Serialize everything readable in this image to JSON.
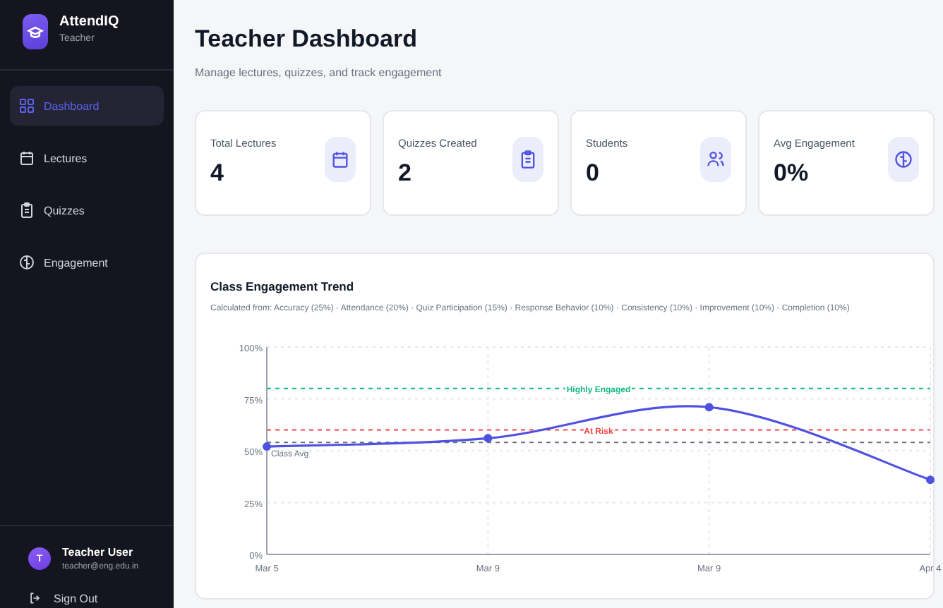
{
  "sidebar": {
    "brand": {
      "name": "AttendIQ",
      "role": "Teacher"
    },
    "items": [
      {
        "label": "Dashboard",
        "selected": true
      },
      {
        "label": "Lectures",
        "selected": false
      },
      {
        "label": "Quizzes",
        "selected": false
      },
      {
        "label": "Engagement",
        "selected": false
      }
    ],
    "user": {
      "initial": "T",
      "name": "Teacher User",
      "email": "teacher@eng.edu.in"
    },
    "sign_out": "Sign Out"
  },
  "header": {
    "title": "Teacher Dashboard",
    "subtitle": "Manage lectures, quizzes, and track engagement"
  },
  "stats": [
    {
      "label": "Total Lectures",
      "value": "4"
    },
    {
      "label": "Quizzes Created",
      "value": "2"
    },
    {
      "label": "Students",
      "value": "0"
    },
    {
      "label": "Avg Engagement",
      "value": "0%"
    }
  ],
  "trend": {
    "title": "Class Engagement Trend",
    "subtitle": "Calculated from: Accuracy (25%) · Attendance (20%) · Quiz Participation (15%) · Response Behavior (10%) · Consistency (10%) · Improvement (10%) · Completion (10%)",
    "chart_data": {
      "type": "line",
      "categories": [
        "Mar 5",
        "Mar 9",
        "Mar 9",
        "Apr 4"
      ],
      "series": [
        {
          "color": "#4f52e0",
          "marker": "o",
          "values": [
            52,
            56,
            71,
            36
          ]
        }
      ],
      "ylim": [
        0,
        100
      ],
      "grid": true,
      "yticks": [
        {
          "value": 0,
          "label": "0%"
        },
        {
          "value": 25,
          "label": "25%"
        },
        {
          "value": 50,
          "label": "50%"
        },
        {
          "value": 75,
          "label": "75%"
        },
        {
          "value": 100,
          "label": "100%"
        }
      ],
      "ref_lines": [
        {
          "axis": "y",
          "value": 80,
          "label": "Highly Engaged",
          "color": "#10b981"
        },
        {
          "axis": "y",
          "value": 60,
          "label": "At Risk",
          "color": "#ef4444"
        },
        {
          "axis": "y",
          "value": 54,
          "label": "Class Avg",
          "color": "#6b7280"
        }
      ]
    }
  }
}
